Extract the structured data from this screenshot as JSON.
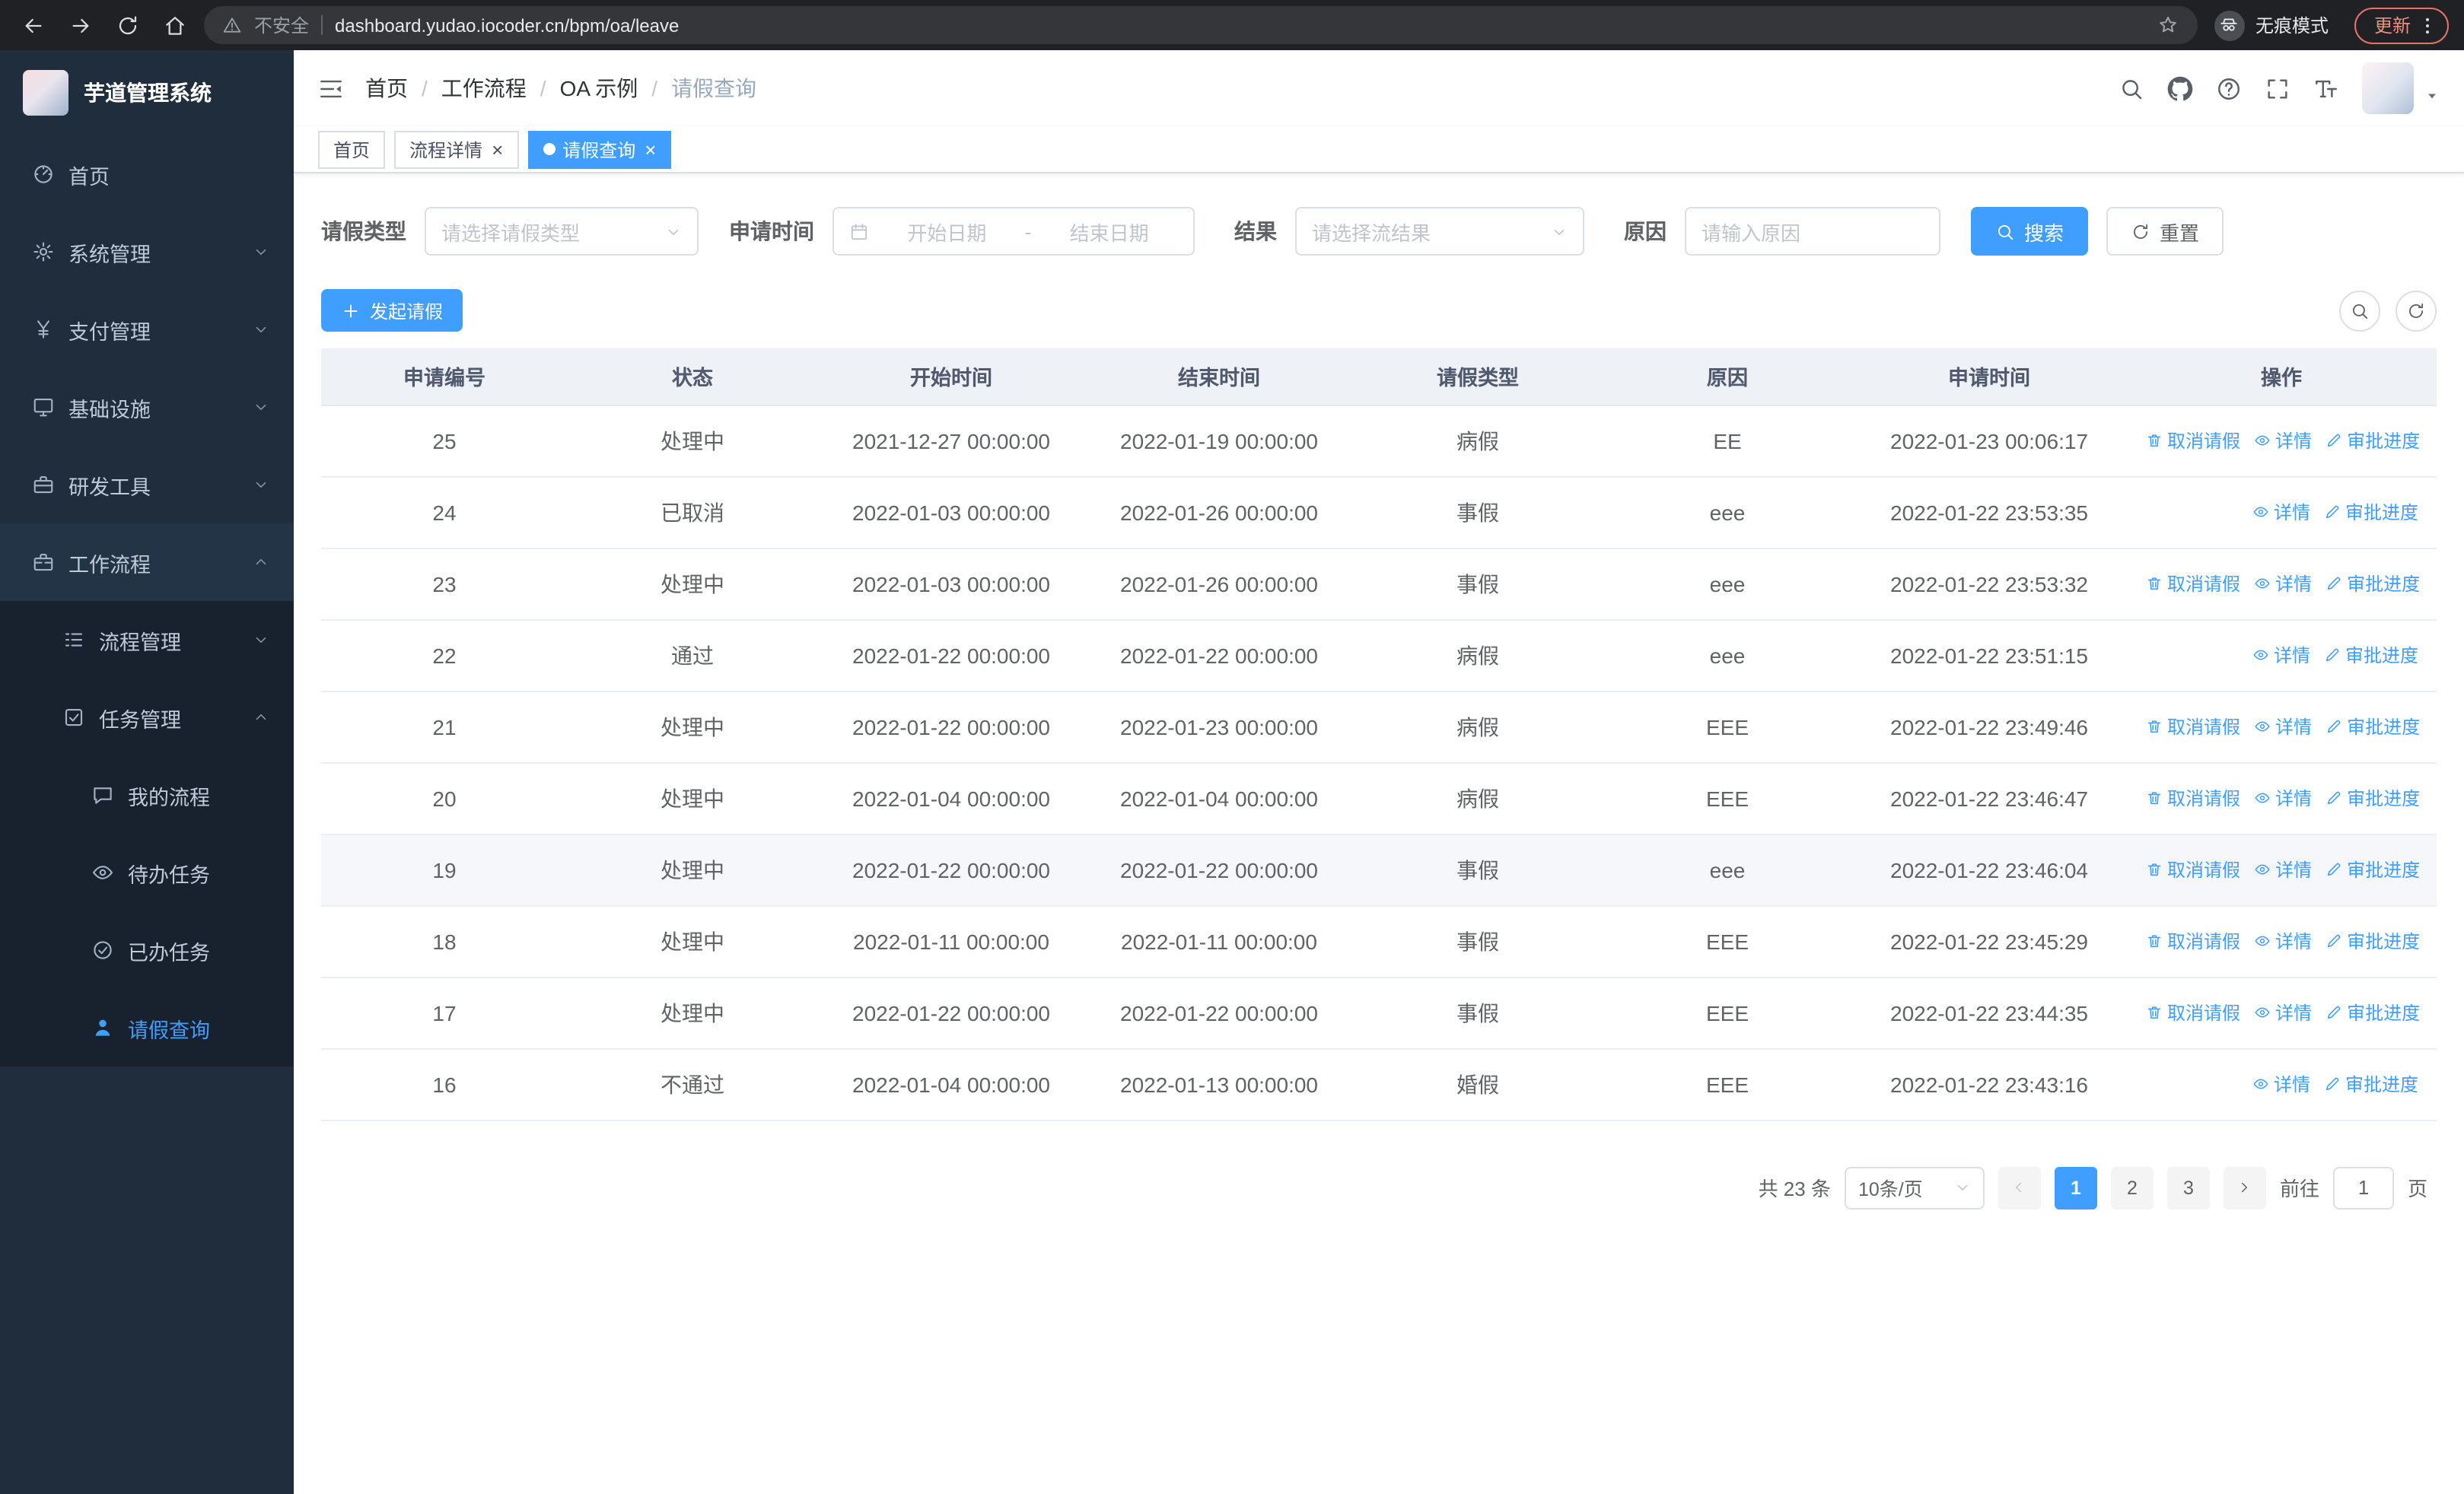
{
  "colors": {
    "primary": "#409eff"
  },
  "browser": {
    "warning_text": "不安全",
    "url": "dashboard.yudao.iocoder.cn/bpm/oa/leave",
    "incognito_label": "无痕模式",
    "update_label": "更新"
  },
  "sidebar": {
    "logo_title": "芋道管理系统",
    "menu": [
      {
        "label": "首页",
        "icon": "dashboard-icon",
        "level": 0
      },
      {
        "label": "系统管理",
        "icon": "gear-icon",
        "level": 0,
        "chevron": "down"
      },
      {
        "label": "支付管理",
        "icon": "yen-icon",
        "level": 0,
        "chevron": "down"
      },
      {
        "label": "基础设施",
        "icon": "monitor-icon",
        "level": 0,
        "chevron": "down"
      },
      {
        "label": "研发工具",
        "icon": "briefcase-icon",
        "level": 0,
        "chevron": "down"
      },
      {
        "label": "工作流程",
        "icon": "workflow-icon",
        "level": 0,
        "chevron": "up",
        "open": true
      },
      {
        "label": "流程管理",
        "icon": "flow-icon",
        "level": 1,
        "chevron": "down",
        "sub": true
      },
      {
        "label": "任务管理",
        "icon": "task-icon",
        "level": 1,
        "chevron": "up",
        "open": true,
        "sub": true
      },
      {
        "label": "我的流程",
        "icon": "message-icon",
        "level": 2,
        "sub": true
      },
      {
        "label": "待办任务",
        "icon": "eye-icon",
        "level": 2,
        "sub": true
      },
      {
        "label": "已办任务",
        "icon": "check-icon",
        "level": 2,
        "sub": true
      },
      {
        "label": "请假查询",
        "icon": "user-icon",
        "level": 2,
        "sub": true,
        "active": true
      }
    ]
  },
  "header": {
    "breadcrumb": [
      "首页",
      "工作流程",
      "OA 示例",
      "请假查询"
    ]
  },
  "tabs": [
    {
      "label": "首页",
      "closable": false,
      "active": false
    },
    {
      "label": "流程详情",
      "closable": true,
      "active": false
    },
    {
      "label": "请假查询",
      "closable": true,
      "active": true
    }
  ],
  "filters": {
    "leave_type_label": "请假类型",
    "leave_type_placeholder": "请选择请假类型",
    "apply_time_label": "申请时间",
    "start_date_placeholder": "开始日期",
    "date_separator": "-",
    "end_date_placeholder": "结束日期",
    "result_label": "结果",
    "result_placeholder": "请选择流结果",
    "reason_label": "原因",
    "reason_placeholder": "请输入原因",
    "search_label": "搜索",
    "reset_label": "重置"
  },
  "toolbar": {
    "create_label": "发起请假"
  },
  "table": {
    "columns": [
      "申请编号",
      "状态",
      "开始时间",
      "结束时间",
      "请假类型",
      "原因",
      "申请时间",
      "操作"
    ],
    "action_labels": {
      "cancel": "取消请假",
      "detail": "详情",
      "progress": "审批进度"
    },
    "rows": [
      {
        "id": "25",
        "status": "处理中",
        "start": "2021-12-27 00:00:00",
        "end": "2022-01-19 00:00:00",
        "type": "病假",
        "reason": "EE",
        "applied": "2022-01-23 00:06:17",
        "cancelable": true,
        "highlighted": false
      },
      {
        "id": "24",
        "status": "已取消",
        "start": "2022-01-03 00:00:00",
        "end": "2022-01-26 00:00:00",
        "type": "事假",
        "reason": "eee",
        "applied": "2022-01-22 23:53:35",
        "cancelable": false,
        "highlighted": false
      },
      {
        "id": "23",
        "status": "处理中",
        "start": "2022-01-03 00:00:00",
        "end": "2022-01-26 00:00:00",
        "type": "事假",
        "reason": "eee",
        "applied": "2022-01-22 23:53:32",
        "cancelable": true,
        "highlighted": false
      },
      {
        "id": "22",
        "status": "通过",
        "start": "2022-01-22 00:00:00",
        "end": "2022-01-22 00:00:00",
        "type": "病假",
        "reason": "eee",
        "applied": "2022-01-22 23:51:15",
        "cancelable": false,
        "highlighted": false
      },
      {
        "id": "21",
        "status": "处理中",
        "start": "2022-01-22 00:00:00",
        "end": "2022-01-23 00:00:00",
        "type": "病假",
        "reason": "EEE",
        "applied": "2022-01-22 23:49:46",
        "cancelable": true,
        "highlighted": false
      },
      {
        "id": "20",
        "status": "处理中",
        "start": "2022-01-04 00:00:00",
        "end": "2022-01-04 00:00:00",
        "type": "病假",
        "reason": "EEE",
        "applied": "2022-01-22 23:46:47",
        "cancelable": true,
        "highlighted": false
      },
      {
        "id": "19",
        "status": "处理中",
        "start": "2022-01-22 00:00:00",
        "end": "2022-01-22 00:00:00",
        "type": "事假",
        "reason": "eee",
        "applied": "2022-01-22 23:46:04",
        "cancelable": true,
        "highlighted": true
      },
      {
        "id": "18",
        "status": "处理中",
        "start": "2022-01-11 00:00:00",
        "end": "2022-01-11 00:00:00",
        "type": "事假",
        "reason": "EEE",
        "applied": "2022-01-22 23:45:29",
        "cancelable": true,
        "highlighted": false
      },
      {
        "id": "17",
        "status": "处理中",
        "start": "2022-01-22 00:00:00",
        "end": "2022-01-22 00:00:00",
        "type": "事假",
        "reason": "EEE",
        "applied": "2022-01-22 23:44:35",
        "cancelable": true,
        "highlighted": false
      },
      {
        "id": "16",
        "status": "不通过",
        "start": "2022-01-04 00:00:00",
        "end": "2022-01-13 00:00:00",
        "type": "婚假",
        "reason": "EEE",
        "applied": "2022-01-22 23:43:16",
        "cancelable": false,
        "highlighted": false
      }
    ]
  },
  "pagination": {
    "total_text": "共 23 条",
    "page_size": "10条/页",
    "pages": [
      "1",
      "2",
      "3"
    ],
    "active_page": "1",
    "goto_label": "前往",
    "goto_value": "1",
    "page_suffix": "页"
  }
}
